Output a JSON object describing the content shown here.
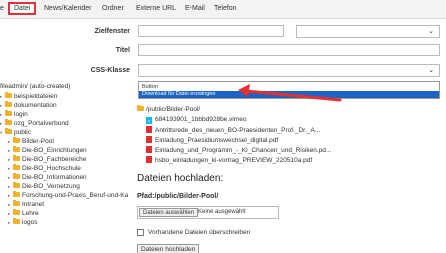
{
  "tabs": [
    "e",
    "Datei",
    "News/Kalender",
    "Ordner",
    "Externe URL",
    "E-Mail",
    "Telefon"
  ],
  "colors": {
    "active_tab_border": "#e4313b",
    "selected_option": "#1b63c5",
    "arrow": "#e53030",
    "folder": "#f2b22d"
  },
  "form": {
    "target_label": "Zielfenster",
    "title_label": "Titel",
    "css_label": "CSS-Klasse",
    "css_options": [
      "Button",
      "Download für Datei erzwingen"
    ],
    "css_selected": "Download für Datei erzwingen"
  },
  "tree": [
    {
      "label": "fileadmin/ (auto-created)",
      "icon": "folder-icon"
    },
    {
      "label": "beispieldateien",
      "icon": "folder-icon"
    },
    {
      "label": "dokumentation",
      "icon": "folder-icon"
    },
    {
      "label": "login",
      "icon": "folder-icon"
    },
    {
      "label": "ozg_Portalverbund",
      "icon": "folder-icon"
    },
    {
      "label": "public",
      "icon": "folder-icon"
    },
    {
      "label": "Bilder-Pool",
      "icon": "folder-icon"
    },
    {
      "label": "Die-BO_Einrichtungen",
      "icon": "folder-icon"
    },
    {
      "label": "Die-BO_Fachbereiche",
      "icon": "folder-icon"
    },
    {
      "label": "Die-BO_Hochschule",
      "icon": "folder-icon"
    },
    {
      "label": "Die-BO_Informationen",
      "icon": "folder-icon"
    },
    {
      "label": "Die-BO_Vernetzung",
      "icon": "folder-icon"
    },
    {
      "label": "Forschung-und-Praxis_Beruf-und-Ka",
      "icon": "folder-icon"
    },
    {
      "label": "Intranet",
      "icon": "folder-icon"
    },
    {
      "label": "Lehre",
      "icon": "folder-icon"
    },
    {
      "label": "logos",
      "icon": "folder-icon"
    }
  ],
  "files": {
    "path": "/public/Bilder-Pool/",
    "items": [
      {
        "name": "684193901_1bbbd928be.vimeo",
        "icon": "vimeo-icon"
      },
      {
        "name": "Antrittsrede_des_neuen_BO-Praesidenten_Prof._Dr._A...",
        "icon": "pdf-icon"
      },
      {
        "name": "Einladung_Praesidiumswechsel_digital.pdf",
        "icon": "pdf-icon"
      },
      {
        "name": "Einladung_und_Programm_-_KI_Chancen_und_Risiken.pd...",
        "icon": "pdf-icon"
      },
      {
        "name": "hsbo_einladungen_ki-vortrag_PREVIEW_220510a.pdf",
        "icon": "pdf-icon"
      }
    ]
  },
  "upload": {
    "heading": "Dateien hochladen:",
    "path_label": "Pfad:/public/Bilder-Pool/",
    "choose_button": "Dateien auswählen",
    "none_chosen": "Keine ausgewählt",
    "overwrite_label": "Vorhandene Dateien überschreiben",
    "upload_button": "Dateien hochladen"
  }
}
